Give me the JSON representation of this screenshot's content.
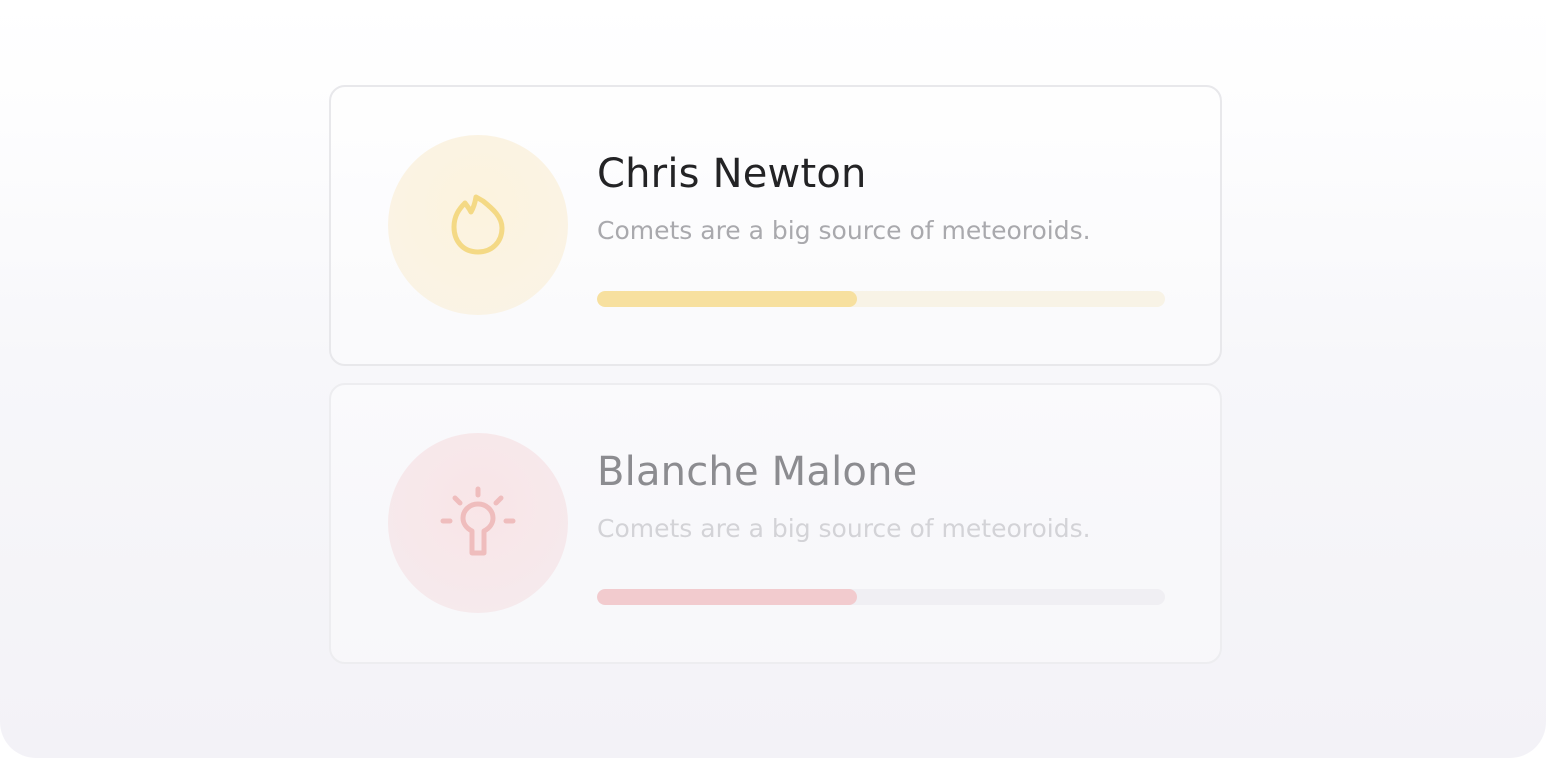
{
  "cards": [
    {
      "name": "Chris Newton",
      "description": "Comets are a big source of meteoroids.",
      "icon": "flame-icon",
      "accent": "#f7e09f",
      "progress": 0.458
    },
    {
      "name": "Blanche Malone",
      "description": "Comets are a big source of meteoroids.",
      "icon": "lightbulb-icon",
      "accent": "#f2cbce",
      "progress": 0.458
    }
  ]
}
